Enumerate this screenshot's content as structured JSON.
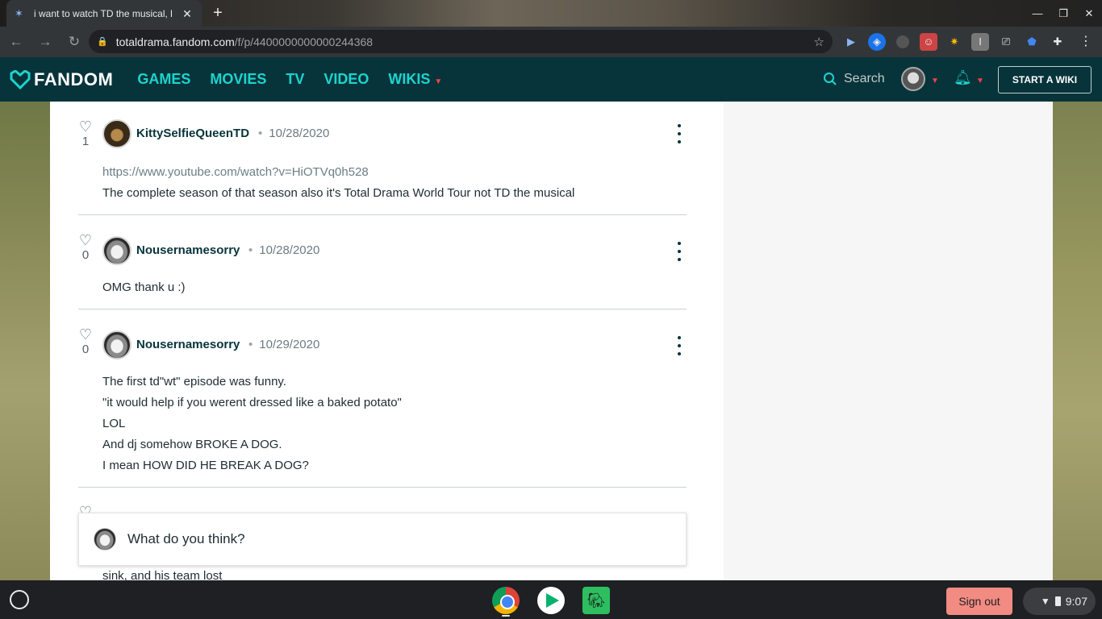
{
  "browser": {
    "tab_title": "i want to watch TD the musical, l",
    "url_host": "totaldrama.fandom.com",
    "url_path": "/f/p/4400000000000244368"
  },
  "fandom_nav": {
    "logo": "FANDOM",
    "links": [
      "GAMES",
      "MOVIES",
      "TV",
      "VIDEO",
      "WIKIS"
    ],
    "search_label": "Search",
    "start_wiki": "START A WIKI"
  },
  "replies": [
    {
      "likes": "1",
      "username": "KittySelfieQueenTD",
      "date": "10/28/2020",
      "link": "https://www.youtube.com/watch?v=HiOTVq0h528",
      "lines": [
        "The complete season of that season also it's Total Drama World Tour not TD the musical"
      ]
    },
    {
      "likes": "0",
      "username": "Nousernamesorry",
      "date": "10/28/2020",
      "lines": [
        "OMG thank u :)"
      ]
    },
    {
      "likes": "0",
      "username": "Nousernamesorry",
      "date": "10/29/2020",
      "lines": [
        "The first td\"wt\" episode was funny.",
        "\"it would help if you werent dressed like a baked potato\"",
        "LOL",
        "And dj somehow BROKE A DOG.",
        "I mean HOW DID HE BREAK A DOG?"
      ]
    }
  ],
  "composer": {
    "placeholder": "What do you think?"
  },
  "peek_text": "sink, and his team lost",
  "shelf": {
    "sign_out": "Sign out",
    "time": "9:07"
  }
}
